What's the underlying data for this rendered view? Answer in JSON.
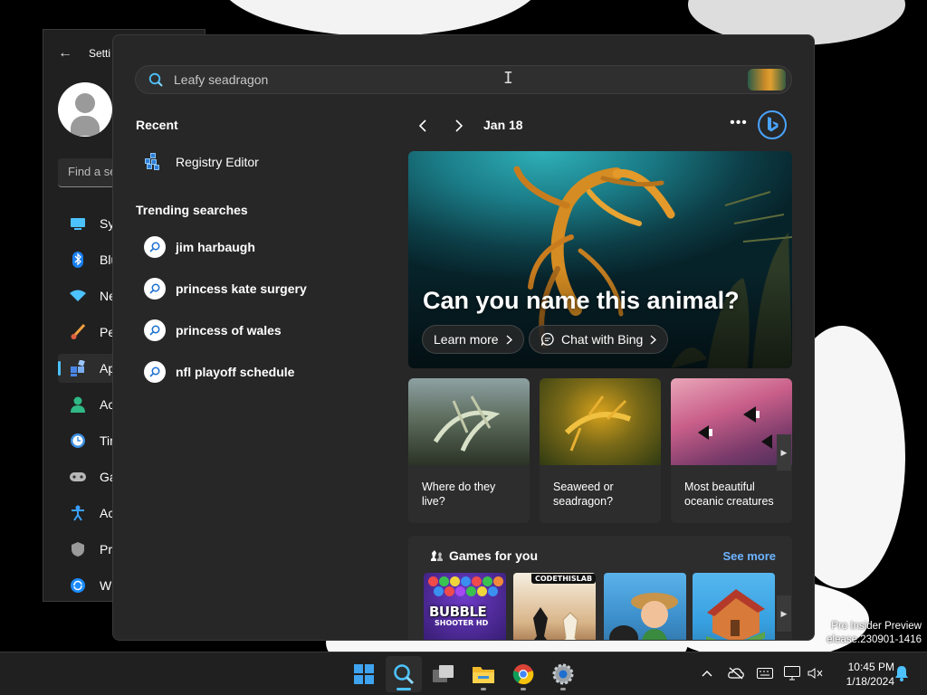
{
  "desktop": {
    "watermark_line1": "Pro Insider Preview",
    "watermark_line2": "elease.230901-1416"
  },
  "settings_window": {
    "title": "Setti",
    "find_placeholder": "Find a se",
    "nav": [
      {
        "label": "Sys",
        "icon": "system-icon"
      },
      {
        "label": "Blu",
        "icon": "bluetooth-icon"
      },
      {
        "label": "Ne",
        "icon": "network-icon"
      },
      {
        "label": "Per",
        "icon": "personalization-icon"
      },
      {
        "label": "Ap",
        "icon": "apps-icon",
        "active": true
      },
      {
        "label": "Acc",
        "icon": "accounts-icon"
      },
      {
        "label": "Tin",
        "icon": "time-language-icon"
      },
      {
        "label": "Ga",
        "icon": "gaming-icon"
      },
      {
        "label": "Acc",
        "icon": "accessibility-icon"
      },
      {
        "label": "Pri",
        "icon": "privacy-icon"
      },
      {
        "label": "Wi",
        "icon": "windows-update-icon"
      }
    ]
  },
  "search": {
    "placeholder": "Leafy seadragon",
    "recent_heading": "Recent",
    "recent": [
      {
        "label": "Registry Editor"
      }
    ],
    "trending_heading": "Trending searches",
    "trending": [
      {
        "label": "jim harbaugh"
      },
      {
        "label": "princess kate surgery"
      },
      {
        "label": "princess of wales"
      },
      {
        "label": "nfl playoff schedule"
      }
    ]
  },
  "highlights": {
    "date": "Jan 18",
    "hero_title": "Can you name this animal?",
    "learn_more": "Learn more",
    "chat_with_bing": "Chat with Bing",
    "cards": [
      {
        "caption": "Where do they live?"
      },
      {
        "caption": "Seaweed or seadragon?"
      },
      {
        "caption": "Most beautiful oceanic creatures"
      }
    ],
    "games_title": "Games for you",
    "see_more": "See more",
    "games": [
      {
        "name": "BUBBLE",
        "sub": "SHOOTER HD"
      },
      {
        "name": "CODETHISLAB"
      },
      {
        "name": ""
      },
      {
        "name": ""
      }
    ]
  },
  "taskbar": {
    "time": "10:45 PM",
    "date": "1/18/2024",
    "apps": [
      "start-icon",
      "search-icon",
      "task-view-icon",
      "file-explorer-icon",
      "chrome-icon",
      "settings-icon"
    ]
  },
  "colors": {
    "accent": "#4cc2ff",
    "link": "#6cb4ff",
    "flyout_bg": "#272727"
  }
}
